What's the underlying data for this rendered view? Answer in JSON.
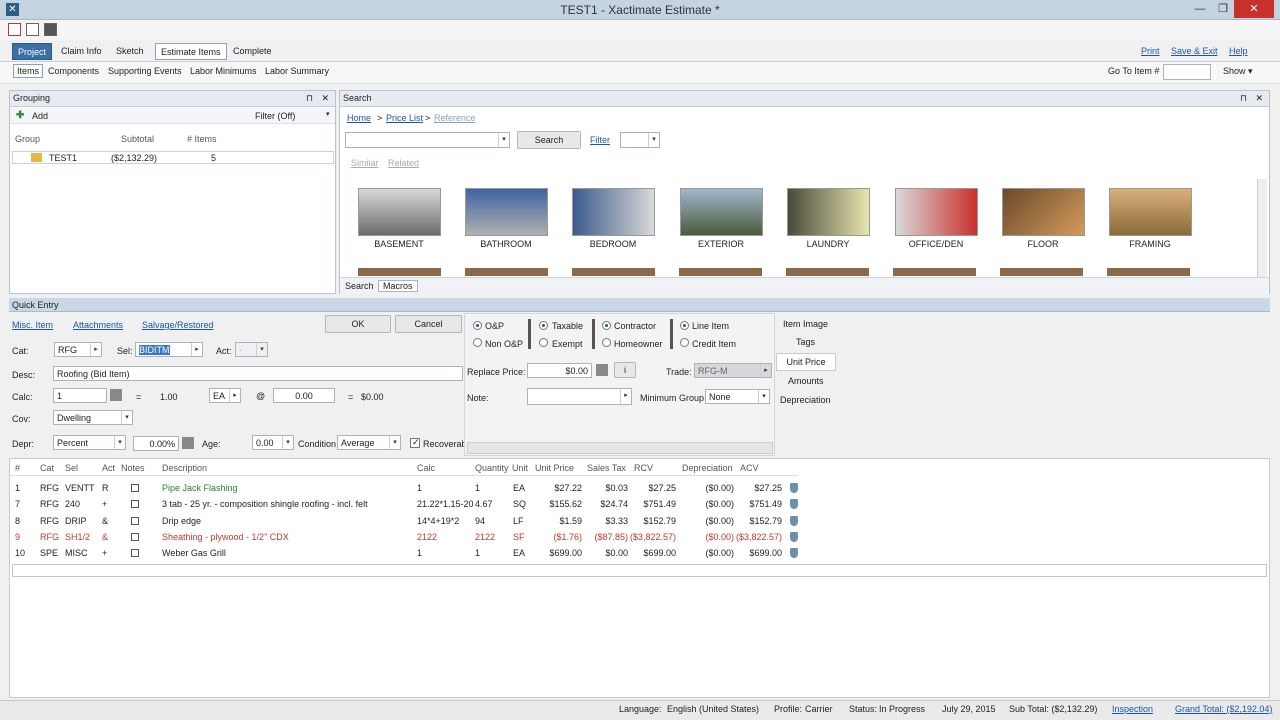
{
  "window": {
    "title": "TEST1 - Xactimate Estimate *",
    "min": "—",
    "max": "❐",
    "close": "✕"
  },
  "menu": {
    "tabs": [
      "Project",
      "Claim Info",
      "Sketch",
      "Estimate Items",
      "Complete"
    ],
    "links": [
      "Print",
      "Save & Exit",
      "Help"
    ]
  },
  "subnav": {
    "items": [
      "Items",
      "Components",
      "Supporting Events",
      "Labor Minimums",
      "Labor Summary"
    ],
    "goto_label": "Go To Item #",
    "show": "Show"
  },
  "grouping": {
    "title": "Grouping",
    "add": "Add",
    "filter": "Filter (Off)",
    "headers": [
      "Group",
      "Subtotal",
      "# Items"
    ],
    "row": {
      "name": "TEST1",
      "subtotal": "($2,132.29)",
      "items": "5"
    }
  },
  "search": {
    "title": "Search",
    "breadcrumb": [
      "Home",
      ">",
      "Price List",
      ">",
      "Reference"
    ],
    "button": "Search",
    "filter": "Filter",
    "similar": "Similar",
    "related": "Related",
    "categories": [
      "BASEMENT",
      "BATHROOM",
      "BEDROOM",
      "EXTERIOR",
      "LAUNDRY",
      "OFFICE/DEN",
      "FLOOR",
      "FRAMING"
    ],
    "tabs": [
      "Search",
      "Macros"
    ]
  },
  "quick": {
    "title": "Quick Entry",
    "misc": "Misc. Item",
    "attachments": "Attachments",
    "salvage": "Salvage/Restored",
    "ok": "OK",
    "cancel": "Cancel",
    "cat_label": "Cat:",
    "cat": "RFG",
    "sel_label": "Sel:",
    "sel": "BIDITM",
    "act_label": "Act:",
    "act": "-",
    "desc_label": "Desc:",
    "desc": "Roofing (Bid Item)",
    "calc_label": "Calc:",
    "calc": "1",
    "eq1": "=",
    "qty": "1.00",
    "unit": "EA",
    "at": "@",
    "price": "0.00",
    "eq2": "=",
    "total": "$0.00",
    "cov_label": "Cov:",
    "cov": "Dwelling",
    "depr_label": "Depr:",
    "depr": "Percent",
    "depr_pct": "0.00%",
    "age_label": "Age:",
    "age": "0.00",
    "cond_label": "Condition",
    "cond": "Average",
    "recov": "Recoverable",
    "op": "O&P",
    "nonop": "Non O&P",
    "taxable": "Taxable",
    "exempt": "Exempt",
    "contractor": "Contractor",
    "homeowner": "Homeowner",
    "lineitem": "Line Item",
    "credit": "Credit Item",
    "replace_label": "Replace Price:",
    "replace": "$0.00",
    "info": "i",
    "trade_label": "Trade:",
    "trade": "RFG-M",
    "note_label": "Note:",
    "mingroup_label": "Minimum Group",
    "mingroup": "None",
    "side": [
      "Item Image",
      "Tags",
      "Unit Price",
      "Amounts",
      "Depreciation"
    ]
  },
  "table": {
    "headers": [
      "#",
      "Cat",
      "Sel",
      "Act",
      "Notes",
      "Description",
      "Calc",
      "Quantity",
      "Unit",
      "Unit Price",
      "Sales Tax",
      "RCV",
      "Depreciation",
      "ACV"
    ],
    "rows": [
      [
        "1",
        "RFG",
        "VENTT",
        "R",
        "",
        "Pipe Jack Flashing",
        "1",
        "1",
        "EA",
        "$27.22",
        "$0.03",
        "$27.25",
        "($0.00)",
        "$27.25"
      ],
      [
        "7",
        "RFG",
        "240",
        "+",
        "",
        "3 tab - 25 yr. - composition shingle roofing - incl. felt",
        "21.22*1.15-20",
        "4.67",
        "SQ",
        "$155.62",
        "$24.74",
        "$751.49",
        "($0.00)",
        "$751.49"
      ],
      [
        "8",
        "RFG",
        "DRIP",
        "&",
        "",
        "Drip edge",
        "14*4+19*2",
        "94",
        "LF",
        "$1.59",
        "$3.33",
        "$152.79",
        "($0.00)",
        "$152.79"
      ],
      [
        "9",
        "RFG",
        "SH1/2",
        "&",
        "",
        "Sheathing - plywood - 1/2\" CDX",
        "2122",
        "2122",
        "SF",
        "($1.76)",
        "($87.85)",
        "($3,822.57)",
        "($0.00)",
        "($3,822.57)"
      ],
      [
        "10",
        "SPE",
        "MISC",
        "+",
        "",
        "Weber Gas Grill",
        "1",
        "1",
        "EA",
        "$699.00",
        "$0.00",
        "$699.00",
        "($0.00)",
        "$699.00"
      ]
    ]
  },
  "status": {
    "language_label": "Language:",
    "language": "English (United States)",
    "profile_label": "Profile:",
    "profile": "Carrier",
    "status_label": "Status:",
    "status": "In Progress",
    "date": "July 29, 2015",
    "subtotal": "Sub Total: ($2,132.29)",
    "inspection": "Inspection",
    "grand": "Grand Total: ($2,192.04)"
  }
}
